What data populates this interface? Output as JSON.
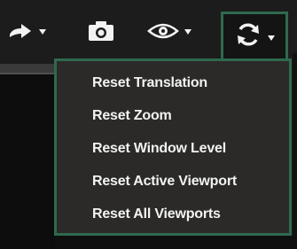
{
  "toolbar": {
    "buttons": [
      {
        "icon": "arrow-right-icon",
        "has_dropdown": true
      },
      {
        "icon": "camera-icon",
        "has_dropdown": false
      },
      {
        "icon": "eye-icon",
        "has_dropdown": true
      },
      {
        "icon": "refresh-icon",
        "has_dropdown": true,
        "active": true
      }
    ]
  },
  "reset_menu": {
    "items": [
      {
        "label": "Reset Translation"
      },
      {
        "label": "Reset Zoom"
      },
      {
        "label": "Reset Window Level"
      },
      {
        "label": "Reset Active Viewport"
      },
      {
        "label": "Reset All Viewports"
      }
    ]
  },
  "colors": {
    "accent": "#2e6a4e",
    "menu_bg": "#2b2a28",
    "text": "#f3f3f3"
  }
}
